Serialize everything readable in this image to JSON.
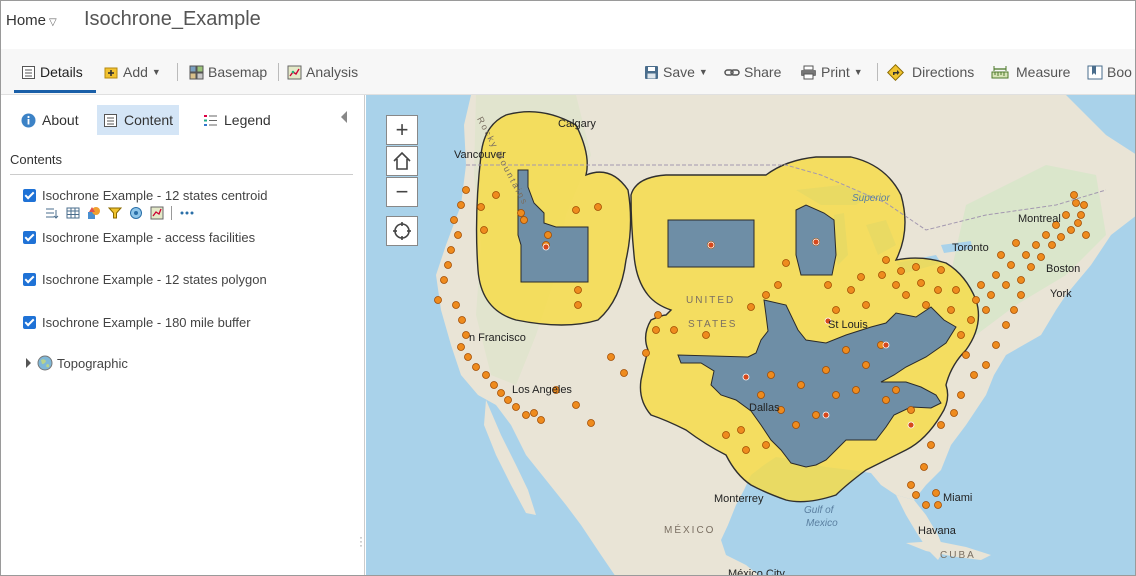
{
  "header": {
    "home_label": "Home",
    "map_title": "Isochrone_Example"
  },
  "toolbar": {
    "details": "Details",
    "add": "Add",
    "basemap": "Basemap",
    "analysis": "Analysis",
    "save": "Save",
    "share": "Share",
    "print": "Print",
    "directions": "Directions",
    "measure": "Measure",
    "bookmarks": "Boo"
  },
  "panel": {
    "tabs": [
      {
        "label": "About",
        "icon": "info-icon"
      },
      {
        "label": "Content",
        "icon": "content-icon",
        "active": true
      },
      {
        "label": "Legend",
        "icon": "legend-icon"
      }
    ],
    "contents_heading": "Contents",
    "layers": [
      {
        "label": "Isochrone Example - 12 states centroid",
        "checked": true
      },
      {
        "label": "Isochrone Example - access facilities",
        "checked": true
      },
      {
        "label": "Isochrone Example - 12 states polygon",
        "checked": true
      },
      {
        "label": "Isochrone Example - 180 mile buffer",
        "checked": true
      }
    ],
    "basemap_layer": "Topographic"
  },
  "map": {
    "labels": {
      "calgary": "Calgary",
      "vancouver": "Vancouver",
      "montreal": "Montreal",
      "toronto": "Toronto",
      "boston": "Boston",
      "new_york": "York",
      "san_francisco": "n Francisco",
      "los_angeles": "Los Angeles",
      "monterrey": "Monterrey",
      "miami": "Miami",
      "havana": "Havana",
      "cuba": "CUBA",
      "mexico": "MÉXICO",
      "united": "UNITED",
      "states": "STATES",
      "gulf1": "Gulf of",
      "gulf2": "Mexico",
      "superior": "Superior",
      "rocky": "Rocky Mountains",
      "st_louis": "St Louis",
      "dallas": "Dallas",
      "mexico_city": "México City"
    },
    "colors": {
      "land": "#e9e4d6",
      "water": "#a9d2ea",
      "buffer": "#f7dc45",
      "state": "#6e8ea6",
      "facility": "#ee8b1e"
    }
  }
}
